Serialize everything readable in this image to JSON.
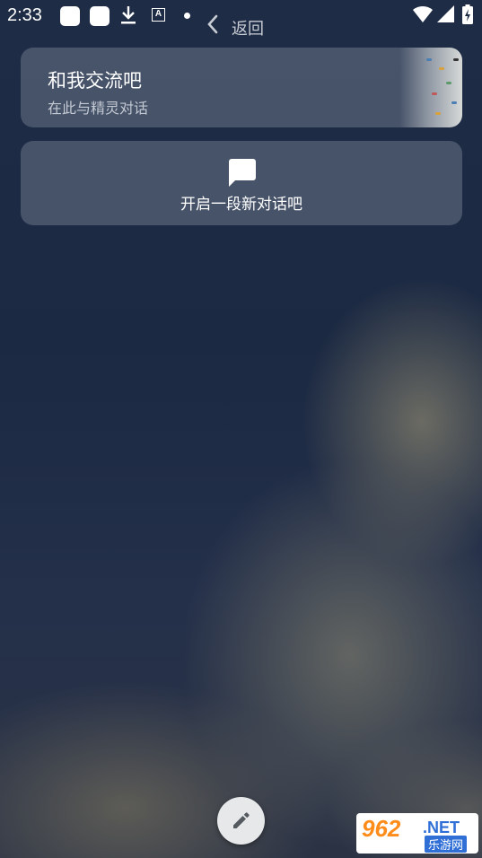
{
  "status_bar": {
    "time": "2:33",
    "icons": [
      "app-notification-icon",
      "app-notification-icon",
      "download-icon",
      "a-text-icon",
      "dot-icon",
      "wifi-icon",
      "signal-icon",
      "battery-charging-icon"
    ]
  },
  "nav": {
    "back_label": "返回"
  },
  "intro_card": {
    "title": "和我交流吧",
    "subtitle": "在此与精灵对话"
  },
  "new_chat_card": {
    "label": "开启一段新对话吧",
    "icon": "chat-bubble-icon"
  },
  "fab": {
    "icon": "pencil-icon"
  },
  "watermark": {
    "number": "962",
    "domain": ".NET",
    "name": "乐游网"
  }
}
